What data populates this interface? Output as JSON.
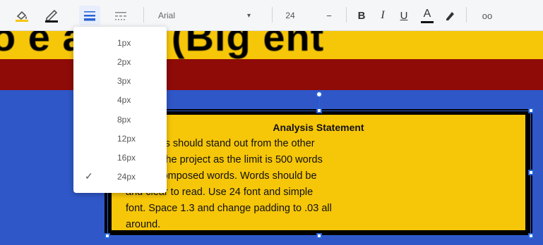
{
  "toolbar": {
    "font_name": "Arial",
    "font_size": "24",
    "bold_label": "B",
    "italic_label": "I",
    "underline_label": "U",
    "text_color_label": "A",
    "more_label": "oo",
    "minus_label": "−",
    "icons": [
      "fill-color-icon",
      "border-color-icon",
      "border-weight-icon",
      "border-dash-icon",
      "highlight-icon"
    ]
  },
  "border_weight_menu": {
    "items": [
      {
        "label": "1px",
        "selected": false
      },
      {
        "label": "2px",
        "selected": false
      },
      {
        "label": "3px",
        "selected": false
      },
      {
        "label": "4px",
        "selected": false
      },
      {
        "label": "8px",
        "selected": false
      },
      {
        "label": "12px",
        "selected": false
      },
      {
        "label": "16px",
        "selected": false
      },
      {
        "label": "24px",
        "selected": true
      }
    ],
    "check_glyph": "✓"
  },
  "slide": {
    "title_fragment": "o e  amer (Big  ent",
    "text_box": {
      "title": "Analysis Statement",
      "lines": [
        "ent words should stand out from the other",
        "s within the project as the limit is 500 words",
        "tudent composed words. Words should be",
        "and clear to read. Use 24 font and simple",
        "font. Space 1.3 and change padding to .03 all",
        "around."
      ]
    }
  },
  "colors": {
    "slide_yellow": "#f6c609",
    "slide_red": "#8e0b08",
    "slide_blue": "#2f57c8",
    "selection": "#2a63d6"
  }
}
